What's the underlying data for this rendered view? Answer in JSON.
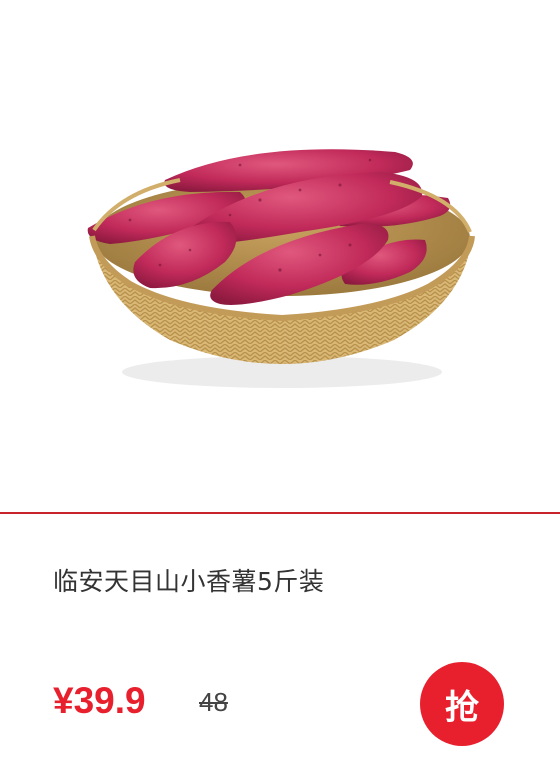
{
  "product": {
    "image_alt": "sweet potatoes in a woven basket",
    "title": "临安天目山小香薯5斤装",
    "price": "¥39.9",
    "original_price": "48",
    "buy_button_label": "抢"
  },
  "colors": {
    "accent": "#e8202e",
    "divider": "#c9242b",
    "potato": "#c12a5a",
    "basket": "#d8b572"
  }
}
